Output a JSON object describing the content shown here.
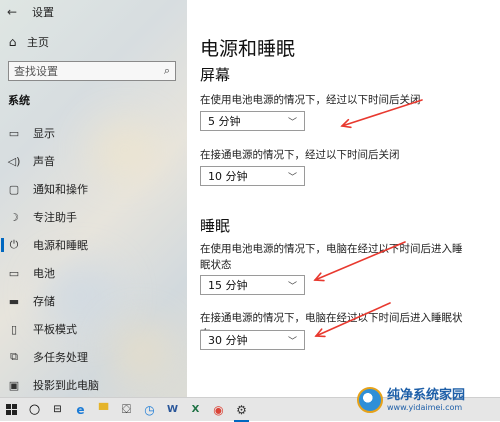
{
  "app": {
    "title": "设置",
    "back_icon": "back-arrow-icon"
  },
  "sidebar": {
    "home_label": "主页",
    "search_placeholder": "查找设置",
    "section_label": "系统",
    "items": [
      {
        "label": "显示",
        "icon": "display-icon",
        "glyph": "▭"
      },
      {
        "label": "声音",
        "icon": "speaker-icon",
        "glyph": "◁)"
      },
      {
        "label": "通知和操作",
        "icon": "notification-icon",
        "glyph": "▢"
      },
      {
        "label": "专注助手",
        "icon": "moon-icon",
        "glyph": "☽"
      },
      {
        "label": "电源和睡眠",
        "icon": "power-icon",
        "glyph": "⏻",
        "active": true
      },
      {
        "label": "电池",
        "icon": "battery-icon",
        "glyph": "▭"
      },
      {
        "label": "存储",
        "icon": "storage-icon",
        "glyph": "▬"
      },
      {
        "label": "平板模式",
        "icon": "tablet-icon",
        "glyph": "▯"
      },
      {
        "label": "多任务处理",
        "icon": "multitask-icon",
        "glyph": "⧉"
      },
      {
        "label": "投影到此电脑",
        "icon": "project-icon",
        "glyph": "▣"
      }
    ]
  },
  "main": {
    "title": "电源和睡眠",
    "screen": {
      "heading": "屏幕",
      "battery_desc": "在使用电池电源的情况下，经过以下时间后关闭",
      "battery_value": "5 分钟",
      "plugged_desc": "在接通电源的情况下，经过以下时间后关闭",
      "plugged_value": "10 分钟"
    },
    "sleep": {
      "heading": "睡眠",
      "battery_desc": "在使用电池电源的情况下，电脑在经过以下时间后进入睡眠状态",
      "battery_value": "15 分钟",
      "plugged_desc": "在接通电源的情况下，电脑在经过以下时间后进入睡眠状态",
      "plugged_value": "30 分钟"
    }
  },
  "annotation_color": "#e8392f",
  "taskbar": {
    "items": [
      "start-icon",
      "search-icon",
      "task-view-icon",
      "edge-icon",
      "file-explorer-icon",
      "store-icon",
      "clock-icon",
      "word-icon",
      "excel-icon",
      "chrome-icon",
      "settings-icon"
    ]
  },
  "watermark": {
    "title": "纯净系统家园",
    "url": "www.yidaimei.com"
  }
}
